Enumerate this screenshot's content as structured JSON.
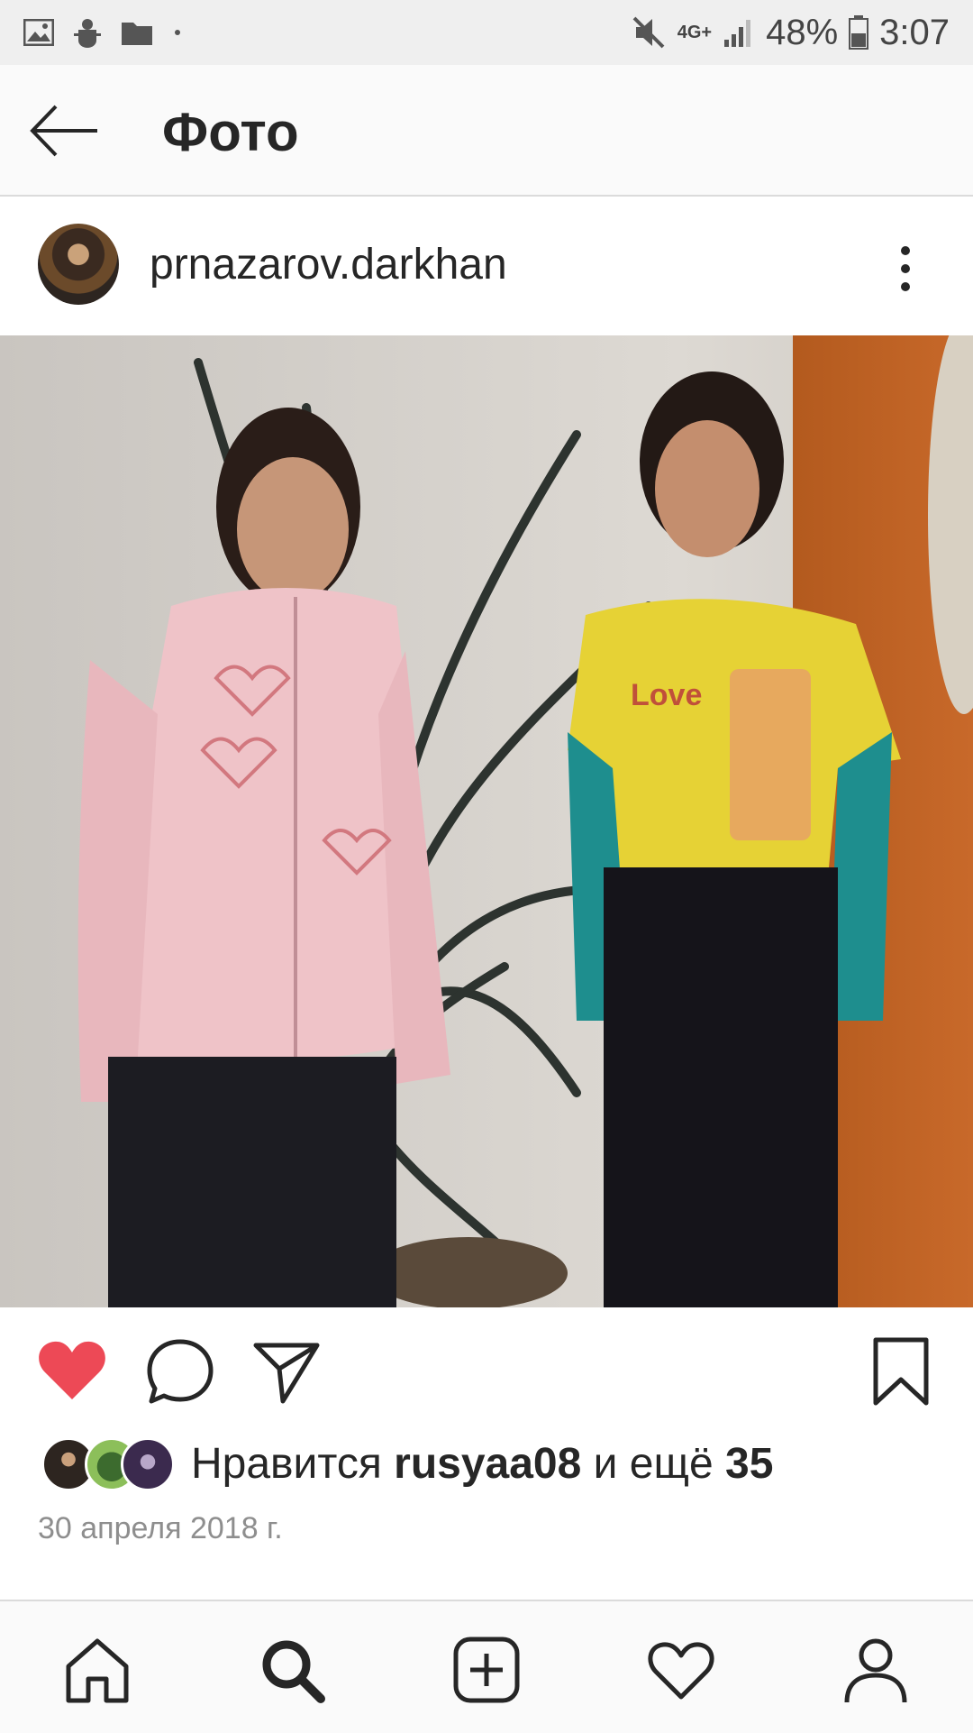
{
  "status_bar": {
    "network": "4G+",
    "battery": "48%",
    "time": "3:07",
    "icons": [
      "image-icon",
      "android-debug-icon",
      "folder-icon",
      "dot-icon",
      "mute-icon",
      "signal-icon",
      "battery-icon"
    ]
  },
  "app_bar": {
    "title": "Фото",
    "back_icon": "arrow-left-icon"
  },
  "post": {
    "username": "prnazarov.darkhan",
    "likes": {
      "prefix": "Нравится ",
      "user": "rusyaa08",
      "middle": " и ещё ",
      "count": "35"
    },
    "date": "30 апреля 2018 г.",
    "liked": true
  },
  "colors": {
    "like_red": "#ed4956",
    "text": "#262626",
    "muted": "#8e8e8e",
    "divider": "#dbdbdb"
  },
  "bottom_nav": [
    "home-icon",
    "search-icon",
    "add-post-icon",
    "activity-heart-icon",
    "profile-icon"
  ]
}
